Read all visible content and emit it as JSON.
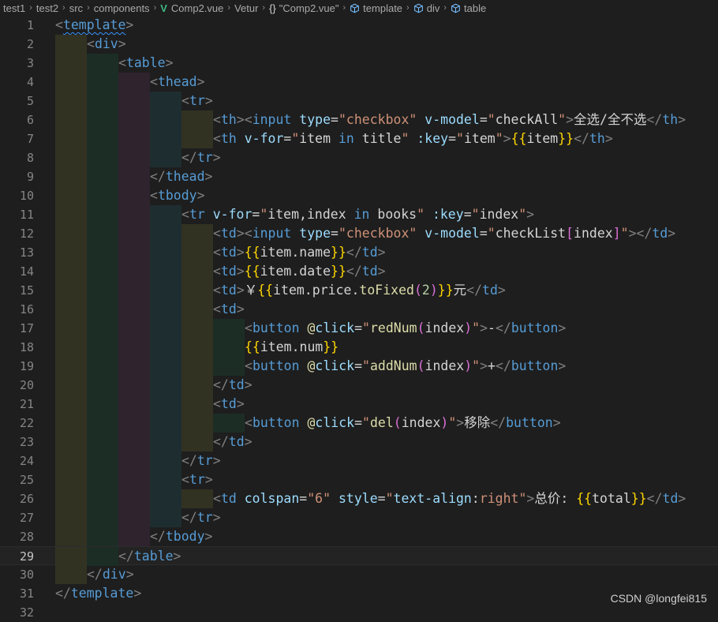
{
  "breadcrumb": [
    {
      "label": "test1",
      "icon": ""
    },
    {
      "label": "test2",
      "icon": ""
    },
    {
      "label": "src",
      "icon": ""
    },
    {
      "label": "components",
      "icon": ""
    },
    {
      "label": "Comp2.vue",
      "icon": "vue-icon"
    },
    {
      "label": "Vetur",
      "icon": ""
    },
    {
      "label": "\"Comp2.vue\"",
      "icon": "braces-icon"
    },
    {
      "label": "template",
      "icon": "cube-icon"
    },
    {
      "label": "div",
      "icon": "cube-icon"
    },
    {
      "label": "table",
      "icon": "cube-icon"
    }
  ],
  "editor": {
    "current_line": 29,
    "indent_colors": [
      "#323223",
      "#1c2d26",
      "#2f232e",
      "#1e2d30"
    ],
    "lines": [
      {
        "n": 1,
        "indent": 0,
        "tokens": [
          [
            "tb",
            "<"
          ],
          [
            "tg",
            "template",
            "squig"
          ],
          [
            "tb",
            ">"
          ]
        ]
      },
      {
        "n": 2,
        "indent": 1,
        "tokens": [
          [
            "tb",
            "<"
          ],
          [
            "tg",
            "div"
          ],
          [
            "tb",
            ">"
          ]
        ]
      },
      {
        "n": 3,
        "indent": 2,
        "tokens": [
          [
            "tb",
            "<"
          ],
          [
            "tg",
            "table"
          ],
          [
            "tb",
            ">"
          ]
        ]
      },
      {
        "n": 4,
        "indent": 3,
        "tokens": [
          [
            "tb",
            "<"
          ],
          [
            "tg",
            "thead"
          ],
          [
            "tb",
            ">"
          ]
        ]
      },
      {
        "n": 5,
        "indent": 4,
        "tokens": [
          [
            "tb",
            "<"
          ],
          [
            "tg",
            "tr"
          ],
          [
            "tb",
            ">"
          ]
        ]
      },
      {
        "n": 6,
        "indent": 5,
        "tokens": [
          [
            "tb",
            "<"
          ],
          [
            "tg",
            "th"
          ],
          [
            "tb",
            "><"
          ],
          [
            "tg",
            "input"
          ],
          [
            "tx",
            " "
          ],
          [
            "at",
            "type"
          ],
          [
            "tx",
            "="
          ],
          [
            "st",
            "\"checkbox\""
          ],
          [
            "tx",
            " "
          ],
          [
            "at",
            "v-model"
          ],
          [
            "tx",
            "="
          ],
          [
            "st",
            "\""
          ],
          [
            "tx",
            "checkAll"
          ],
          [
            "st",
            "\""
          ],
          [
            "tb",
            ">"
          ],
          [
            "tx",
            "全选/全不选"
          ],
          [
            "tb",
            "</"
          ],
          [
            "tg",
            "th"
          ],
          [
            "tb",
            ">"
          ]
        ]
      },
      {
        "n": 7,
        "indent": 5,
        "tokens": [
          [
            "tb",
            "<"
          ],
          [
            "tg",
            "th"
          ],
          [
            "tx",
            " "
          ],
          [
            "at",
            "v-for"
          ],
          [
            "tx",
            "="
          ],
          [
            "st",
            "\""
          ],
          [
            "tx",
            "item "
          ],
          [
            "kw",
            "in"
          ],
          [
            "tx",
            " title"
          ],
          [
            "st",
            "\""
          ],
          [
            "tx",
            " "
          ],
          [
            "at",
            ":key"
          ],
          [
            "tx",
            "="
          ],
          [
            "st",
            "\""
          ],
          [
            "tx",
            "item"
          ],
          [
            "st",
            "\""
          ],
          [
            "tb",
            ">"
          ],
          [
            "cu",
            "{{"
          ],
          [
            "tx",
            "item"
          ],
          [
            "cu",
            "}}"
          ],
          [
            "tb",
            "</"
          ],
          [
            "tg",
            "th"
          ],
          [
            "tb",
            ">"
          ]
        ]
      },
      {
        "n": 8,
        "indent": 4,
        "tokens": [
          [
            "tb",
            "</"
          ],
          [
            "tg",
            "tr"
          ],
          [
            "tb",
            ">"
          ]
        ]
      },
      {
        "n": 9,
        "indent": 3,
        "tokens": [
          [
            "tb",
            "</"
          ],
          [
            "tg",
            "thead"
          ],
          [
            "tb",
            ">"
          ]
        ]
      },
      {
        "n": 10,
        "indent": 3,
        "tokens": [
          [
            "tb",
            "<"
          ],
          [
            "tg",
            "tbody"
          ],
          [
            "tb",
            ">"
          ]
        ]
      },
      {
        "n": 11,
        "indent": 4,
        "tokens": [
          [
            "tb",
            "<"
          ],
          [
            "tg",
            "tr"
          ],
          [
            "tx",
            " "
          ],
          [
            "at",
            "v-for"
          ],
          [
            "tx",
            "="
          ],
          [
            "st",
            "\""
          ],
          [
            "tx",
            "item,index "
          ],
          [
            "kw",
            "in"
          ],
          [
            "tx",
            " books"
          ],
          [
            "st",
            "\""
          ],
          [
            "tx",
            " "
          ],
          [
            "at",
            ":key"
          ],
          [
            "tx",
            "="
          ],
          [
            "st",
            "\""
          ],
          [
            "tx",
            "index"
          ],
          [
            "st",
            "\""
          ],
          [
            "tb",
            ">"
          ]
        ]
      },
      {
        "n": 12,
        "indent": 5,
        "tokens": [
          [
            "tb",
            "<"
          ],
          [
            "tg",
            "td"
          ],
          [
            "tb",
            "><"
          ],
          [
            "tg",
            "input"
          ],
          [
            "tx",
            " "
          ],
          [
            "at",
            "type"
          ],
          [
            "tx",
            "="
          ],
          [
            "st",
            "\"checkbox\""
          ],
          [
            "tx",
            " "
          ],
          [
            "at",
            "v-model"
          ],
          [
            "tx",
            "="
          ],
          [
            "st",
            "\""
          ],
          [
            "tx",
            "checkList"
          ],
          [
            "pa",
            "["
          ],
          [
            "tx",
            "index"
          ],
          [
            "pa",
            "]"
          ],
          [
            "st",
            "\""
          ],
          [
            "tb",
            "></"
          ],
          [
            "tg",
            "td"
          ],
          [
            "tb",
            ">"
          ]
        ]
      },
      {
        "n": 13,
        "indent": 5,
        "tokens": [
          [
            "tb",
            "<"
          ],
          [
            "tg",
            "td"
          ],
          [
            "tb",
            ">"
          ],
          [
            "cu",
            "{{"
          ],
          [
            "tx",
            "item.name"
          ],
          [
            "cu",
            "}}"
          ],
          [
            "tb",
            "</"
          ],
          [
            "tg",
            "td"
          ],
          [
            "tb",
            ">"
          ]
        ]
      },
      {
        "n": 14,
        "indent": 5,
        "tokens": [
          [
            "tb",
            "<"
          ],
          [
            "tg",
            "td"
          ],
          [
            "tb",
            ">"
          ],
          [
            "cu",
            "{{"
          ],
          [
            "tx",
            "item.date"
          ],
          [
            "cu",
            "}}"
          ],
          [
            "tb",
            "</"
          ],
          [
            "tg",
            "td"
          ],
          [
            "tb",
            ">"
          ]
        ]
      },
      {
        "n": 15,
        "indent": 5,
        "tokens": [
          [
            "tb",
            "<"
          ],
          [
            "tg",
            "td"
          ],
          [
            "tb",
            ">"
          ],
          [
            "tx",
            "￥"
          ],
          [
            "cu",
            "{{"
          ],
          [
            "tx",
            "item.price."
          ],
          [
            "fn",
            "toFixed"
          ],
          [
            "pa",
            "("
          ],
          [
            "nb",
            "2"
          ],
          [
            "pa",
            ")"
          ],
          [
            "cu",
            "}}"
          ],
          [
            "tx",
            "元"
          ],
          [
            "tb",
            "</"
          ],
          [
            "tg",
            "td"
          ],
          [
            "tb",
            ">"
          ]
        ]
      },
      {
        "n": 16,
        "indent": 5,
        "tokens": [
          [
            "tb",
            "<"
          ],
          [
            "tg",
            "td"
          ],
          [
            "tb",
            ">"
          ]
        ]
      },
      {
        "n": 17,
        "indent": 6,
        "tokens": [
          [
            "tb",
            "<"
          ],
          [
            "tg",
            "button"
          ],
          [
            "tx",
            " "
          ],
          [
            "cm",
            "@"
          ],
          [
            "at",
            "click"
          ],
          [
            "tx",
            "="
          ],
          [
            "st",
            "\""
          ],
          [
            "fn",
            "redNum"
          ],
          [
            "pa",
            "("
          ],
          [
            "tx",
            "index"
          ],
          [
            "pa",
            ")"
          ],
          [
            "st",
            "\""
          ],
          [
            "tb",
            ">"
          ],
          [
            "tx",
            "-"
          ],
          [
            "tb",
            "</"
          ],
          [
            "tg",
            "button"
          ],
          [
            "tb",
            ">"
          ]
        ]
      },
      {
        "n": 18,
        "indent": 6,
        "tokens": [
          [
            "cu",
            "{{"
          ],
          [
            "tx",
            "item.num"
          ],
          [
            "cu",
            "}}"
          ]
        ]
      },
      {
        "n": 19,
        "indent": 6,
        "tokens": [
          [
            "tb",
            "<"
          ],
          [
            "tg",
            "button"
          ],
          [
            "tx",
            " "
          ],
          [
            "cm",
            "@"
          ],
          [
            "at",
            "click"
          ],
          [
            "tx",
            "="
          ],
          [
            "st",
            "\""
          ],
          [
            "fn",
            "addNum"
          ],
          [
            "pa",
            "("
          ],
          [
            "tx",
            "index"
          ],
          [
            "pa",
            ")"
          ],
          [
            "st",
            "\""
          ],
          [
            "tb",
            ">"
          ],
          [
            "tx",
            "+"
          ],
          [
            "tb",
            "</"
          ],
          [
            "tg",
            "button"
          ],
          [
            "tb",
            ">"
          ]
        ]
      },
      {
        "n": 20,
        "indent": 5,
        "tokens": [
          [
            "tb",
            "</"
          ],
          [
            "tg",
            "td"
          ],
          [
            "tb",
            ">"
          ]
        ]
      },
      {
        "n": 21,
        "indent": 5,
        "tokens": [
          [
            "tb",
            "<"
          ],
          [
            "tg",
            "td"
          ],
          [
            "tb",
            ">"
          ]
        ]
      },
      {
        "n": 22,
        "indent": 6,
        "tokens": [
          [
            "tb",
            "<"
          ],
          [
            "tg",
            "button"
          ],
          [
            "tx",
            " "
          ],
          [
            "cm",
            "@"
          ],
          [
            "at",
            "click"
          ],
          [
            "tx",
            "="
          ],
          [
            "st",
            "\""
          ],
          [
            "fn",
            "del"
          ],
          [
            "pa",
            "("
          ],
          [
            "tx",
            "index"
          ],
          [
            "pa",
            ")"
          ],
          [
            "st",
            "\""
          ],
          [
            "tb",
            ">"
          ],
          [
            "tx",
            "移除"
          ],
          [
            "tb",
            "</"
          ],
          [
            "tg",
            "button"
          ],
          [
            "tb",
            ">"
          ]
        ]
      },
      {
        "n": 23,
        "indent": 5,
        "tokens": [
          [
            "tb",
            "</"
          ],
          [
            "tg",
            "td"
          ],
          [
            "tb",
            ">"
          ]
        ]
      },
      {
        "n": 24,
        "indent": 4,
        "tokens": [
          [
            "tb",
            "</"
          ],
          [
            "tg",
            "tr"
          ],
          [
            "tb",
            ">"
          ]
        ]
      },
      {
        "n": 25,
        "indent": 4,
        "tokens": [
          [
            "tb",
            "<"
          ],
          [
            "tg",
            "tr"
          ],
          [
            "tb",
            ">"
          ]
        ]
      },
      {
        "n": 26,
        "indent": 5,
        "tokens": [
          [
            "tb",
            "<"
          ],
          [
            "tg",
            "td"
          ],
          [
            "tx",
            " "
          ],
          [
            "at",
            "colspan"
          ],
          [
            "tx",
            "="
          ],
          [
            "st",
            "\"6\""
          ],
          [
            "tx",
            " "
          ],
          [
            "at",
            "style"
          ],
          [
            "tx",
            "="
          ],
          [
            "st",
            "\""
          ],
          [
            "at",
            "text-align"
          ],
          [
            "tx",
            ":"
          ],
          [
            "st",
            "right"
          ],
          [
            "st",
            "\""
          ],
          [
            "tb",
            ">"
          ],
          [
            "tx",
            "总价: "
          ],
          [
            "cu",
            "{{"
          ],
          [
            "tx",
            "total"
          ],
          [
            "cu",
            "}}"
          ],
          [
            "tb",
            "</"
          ],
          [
            "tg",
            "td"
          ],
          [
            "tb",
            ">"
          ]
        ]
      },
      {
        "n": 27,
        "indent": 4,
        "tokens": [
          [
            "tb",
            "</"
          ],
          [
            "tg",
            "tr"
          ],
          [
            "tb",
            ">"
          ]
        ]
      },
      {
        "n": 28,
        "indent": 3,
        "tokens": [
          [
            "tb",
            "</"
          ],
          [
            "tg",
            "tbody"
          ],
          [
            "tb",
            ">"
          ]
        ]
      },
      {
        "n": 29,
        "indent": 2,
        "tokens": [
          [
            "tb",
            "</"
          ],
          [
            "tg",
            "table"
          ],
          [
            "tb",
            ">"
          ]
        ]
      },
      {
        "n": 30,
        "indent": 1,
        "tokens": [
          [
            "tb",
            "</"
          ],
          [
            "tg",
            "div"
          ],
          [
            "tb",
            ">"
          ]
        ]
      },
      {
        "n": 31,
        "indent": 0,
        "tokens": [
          [
            "tb",
            "</"
          ],
          [
            "tg",
            "template"
          ],
          [
            "tb",
            ">"
          ]
        ]
      },
      {
        "n": 32,
        "indent": 0,
        "tokens": []
      }
    ]
  },
  "watermark": "CSDN @longfei815"
}
